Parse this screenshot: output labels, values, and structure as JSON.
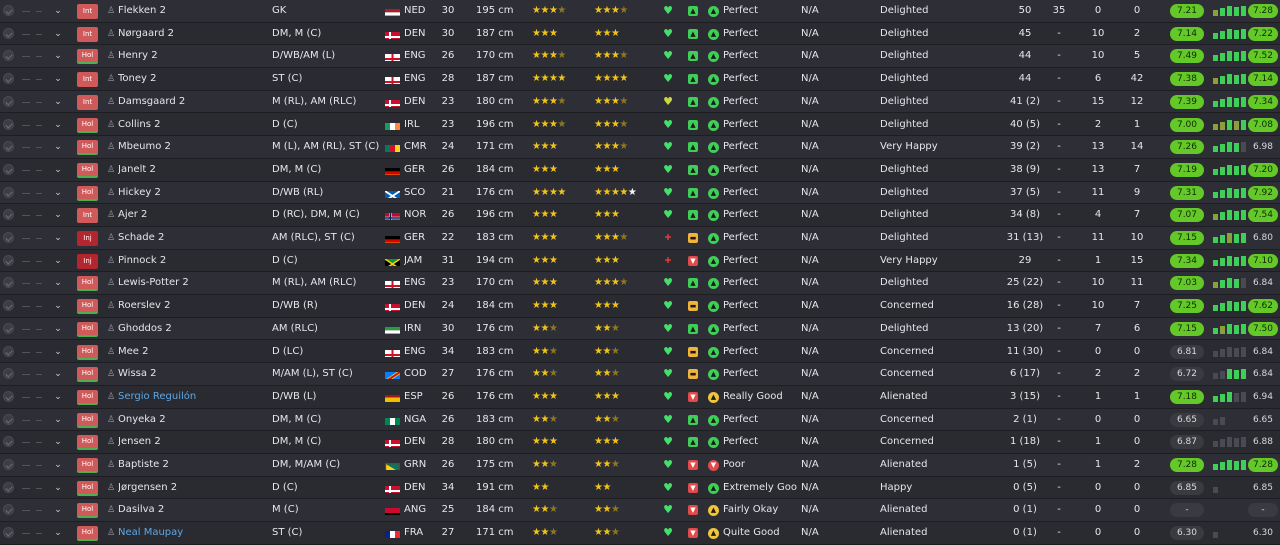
{
  "colors": {
    "star": "#f2c418",
    "rating_green": "#64c928",
    "status_red": "#d05a5a",
    "injured_red": "#b4262e",
    "blue_name": "#5ca8e6",
    "bar_green": "#3fcf58",
    "bar_olive": "#8aa03a",
    "bar_dark": "#4a4a52"
  },
  "players": [
    {
      "status": "Int",
      "name": "Flekken 2",
      "position": "GK",
      "nat": "NED",
      "flag": "ned",
      "age": "30",
      "height": "195 cm",
      "ca": "★★★½",
      "pa": "★★★½",
      "heart": "green",
      "morale": "green",
      "happy_icon": "green",
      "happiness": "Perfect",
      "na": "N/A",
      "feeling": "Delighted",
      "apps": "50",
      "goals": "35",
      "assists": "0",
      "col4": "0",
      "rating": "7.21",
      "rating_style": "green",
      "bars": [
        "o",
        "g",
        "g",
        "g",
        "g"
      ],
      "avg": "7.28",
      "avg_style": "green"
    },
    {
      "status": "Int",
      "name": "Nørgaard 2",
      "position": "DM, M (C)",
      "nat": "DEN",
      "flag": "den",
      "age": "30",
      "height": "187 cm",
      "ca": "★★★",
      "pa": "★★★",
      "heart": "green",
      "morale": "green",
      "happy_icon": "green",
      "happiness": "Perfect",
      "na": "N/A",
      "feeling": "Delighted",
      "apps": "45",
      "goals": "-",
      "assists": "10",
      "col4": "2",
      "rating": "7.14",
      "rating_style": "green",
      "bars": [
        "g",
        "g",
        "g",
        "g",
        "g"
      ],
      "avg": "7.22",
      "avg_style": "green"
    },
    {
      "status": "Hol",
      "name": "Henry 2",
      "position": "D/WB/AM (L)",
      "nat": "ENG",
      "flag": "eng",
      "age": "26",
      "height": "170 cm",
      "ca": "★★★½",
      "pa": "★★★½",
      "heart": "green",
      "morale": "green",
      "happy_icon": "green",
      "happiness": "Perfect",
      "na": "N/A",
      "feeling": "Delighted",
      "apps": "44",
      "goals": "-",
      "assists": "10",
      "col4": "5",
      "rating": "7.49",
      "rating_style": "green",
      "bars": [
        "g",
        "g",
        "g",
        "g",
        "g"
      ],
      "avg": "7.52",
      "avg_style": "green"
    },
    {
      "status": "Int",
      "name": "Toney 2",
      "position": "ST (C)",
      "nat": "ENG",
      "flag": "eng",
      "age": "28",
      "height": "187 cm",
      "ca": "★★★★",
      "pa": "★★★★",
      "heart": "green",
      "morale": "green",
      "happy_icon": "green",
      "happiness": "Perfect",
      "na": "N/A",
      "feeling": "Delighted",
      "apps": "44",
      "goals": "-",
      "assists": "6",
      "col4": "42",
      "rating": "7.38",
      "rating_style": "green",
      "bars": [
        "o",
        "g",
        "g",
        "g",
        "g"
      ],
      "avg": "7.14",
      "avg_style": "green"
    },
    {
      "status": "Int",
      "name": "Damsgaard 2",
      "position": "M (RL), AM (RLC)",
      "nat": "DEN",
      "flag": "den",
      "age": "23",
      "height": "180 cm",
      "ca": "★★★½",
      "pa": "★★★½",
      "heart": "yellowish",
      "morale": "green",
      "happy_icon": "green",
      "happiness": "Perfect",
      "na": "N/A",
      "feeling": "Delighted",
      "apps": "41 (2)",
      "goals": "-",
      "assists": "15",
      "col4": "12",
      "rating": "7.39",
      "rating_style": "green",
      "bars": [
        "g",
        "g",
        "g",
        "g",
        "g"
      ],
      "avg": "7.34",
      "avg_style": "green"
    },
    {
      "status": "Hol",
      "name": "Collins 2",
      "position": "D (C)",
      "nat": "IRL",
      "flag": "irl",
      "age": "23",
      "height": "196 cm",
      "ca": "★★★½",
      "pa": "★★★½",
      "heart": "green",
      "morale": "green",
      "happy_icon": "green",
      "happiness": "Perfect",
      "na": "N/A",
      "feeling": "Delighted",
      "apps": "40 (5)",
      "goals": "-",
      "assists": "2",
      "col4": "1",
      "rating": "7.00",
      "rating_style": "green",
      "bars": [
        "o",
        "o",
        "g",
        "o",
        "g"
      ],
      "avg": "7.08",
      "avg_style": "green"
    },
    {
      "status": "Hol",
      "name": "Mbeumo 2",
      "position": "M (L), AM (RL), ST (C)",
      "nat": "CMR",
      "flag": "cmr",
      "age": "24",
      "height": "171 cm",
      "ca": "★★★",
      "pa": "★★★½",
      "heart": "green",
      "morale": "green",
      "happy_icon": "green",
      "happiness": "Perfect",
      "na": "N/A",
      "feeling": "Very Happy",
      "apps": "39 (2)",
      "goals": "-",
      "assists": "13",
      "col4": "14",
      "rating": "7.26",
      "rating_style": "green",
      "bars": [
        "g",
        "g",
        "g",
        "g",
        "d"
      ],
      "avg": "6.98",
      "avg_style": "grey"
    },
    {
      "status": "Hol",
      "name": "Janelt 2",
      "position": "DM, M (C)",
      "nat": "GER",
      "flag": "ger",
      "age": "26",
      "height": "184 cm",
      "ca": "★★★",
      "pa": "★★★",
      "heart": "green",
      "morale": "green",
      "happy_icon": "green",
      "happiness": "Perfect",
      "na": "N/A",
      "feeling": "Delighted",
      "apps": "38 (9)",
      "goals": "-",
      "assists": "13",
      "col4": "7",
      "rating": "7.19",
      "rating_style": "green",
      "bars": [
        "g",
        "g",
        "g",
        "g",
        "g"
      ],
      "avg": "7.20",
      "avg_style": "green"
    },
    {
      "status": "Hol",
      "name": "Hickey 2",
      "position": "D/WB (RL)",
      "nat": "SCO",
      "flag": "sco",
      "age": "21",
      "height": "176 cm",
      "ca": "★★★★",
      "pa": "★★★★★",
      "heart": "green",
      "morale": "green",
      "happy_icon": "green",
      "happiness": "Perfect",
      "na": "N/A",
      "feeling": "Delighted",
      "apps": "37 (5)",
      "goals": "-",
      "assists": "11",
      "col4": "9",
      "rating": "7.31",
      "rating_style": "green",
      "bars": [
        "g",
        "g",
        "g",
        "g",
        "g"
      ],
      "avg": "7.92",
      "avg_style": "green"
    },
    {
      "status": "Int",
      "name": "Ajer 2",
      "position": "D (RC), DM, M (C)",
      "nat": "NOR",
      "flag": "nor",
      "age": "26",
      "height": "196 cm",
      "ca": "★★★",
      "pa": "★★★",
      "heart": "green",
      "morale": "green",
      "happy_icon": "green",
      "happiness": "Perfect",
      "na": "N/A",
      "feeling": "Delighted",
      "apps": "34 (8)",
      "goals": "-",
      "assists": "4",
      "col4": "7",
      "rating": "7.07",
      "rating_style": "green",
      "bars": [
        "o",
        "g",
        "g",
        "g",
        "g"
      ],
      "avg": "7.54",
      "avg_style": "green"
    },
    {
      "status": "Inj",
      "name": "Schade 2",
      "position": "AM (RLC), ST (C)",
      "nat": "GER",
      "flag": "ger",
      "age": "22",
      "height": "183 cm",
      "ca": "★★★",
      "pa": "★★★½",
      "heart": "red",
      "morale": "yellow",
      "happy_icon": "green",
      "happiness": "Perfect",
      "na": "N/A",
      "feeling": "Delighted",
      "apps": "31 (13)",
      "goals": "-",
      "assists": "11",
      "col4": "10",
      "rating": "7.15",
      "rating_style": "green",
      "bars": [
        "g",
        "g",
        "o",
        "g",
        "g"
      ],
      "avg": "6.80",
      "avg_style": "grey"
    },
    {
      "status": "Inj",
      "name": "Pinnock 2",
      "position": "D (C)",
      "nat": "JAM",
      "flag": "jam",
      "age": "31",
      "height": "194 cm",
      "ca": "★★★",
      "pa": "★★★",
      "heart": "red",
      "morale": "red",
      "happy_icon": "green",
      "happiness": "Perfect",
      "na": "N/A",
      "feeling": "Very Happy",
      "apps": "29",
      "goals": "-",
      "assists": "1",
      "col4": "15",
      "rating": "7.34",
      "rating_style": "green",
      "bars": [
        "g",
        "g",
        "g",
        "g",
        "g"
      ],
      "avg": "7.10",
      "avg_style": "green"
    },
    {
      "status": "Hol",
      "name": "Lewis-Potter 2",
      "position": "M (RL), AM (RLC)",
      "nat": "ENG",
      "flag": "eng",
      "age": "23",
      "height": "170 cm",
      "ca": "★★★",
      "pa": "★★★½",
      "heart": "green",
      "morale": "green",
      "happy_icon": "green",
      "happiness": "Perfect",
      "na": "N/A",
      "feeling": "Delighted",
      "apps": "25 (22)",
      "goals": "-",
      "assists": "10",
      "col4": "11",
      "rating": "7.03",
      "rating_style": "green",
      "bars": [
        "o",
        "g",
        "g",
        "g",
        "d"
      ],
      "avg": "6.84",
      "avg_style": "grey"
    },
    {
      "status": "Hol",
      "name": "Roerslev 2",
      "position": "D/WB (R)",
      "nat": "DEN",
      "flag": "den",
      "age": "24",
      "height": "184 cm",
      "ca": "★★★",
      "pa": "★★★",
      "heart": "green",
      "morale": "yellow",
      "happy_icon": "green",
      "happiness": "Perfect",
      "na": "N/A",
      "feeling": "Concerned",
      "apps": "16 (28)",
      "goals": "-",
      "assists": "10",
      "col4": "7",
      "rating": "7.25",
      "rating_style": "green",
      "bars": [
        "g",
        "g",
        "g",
        "g",
        "g"
      ],
      "avg": "7.62",
      "avg_style": "green"
    },
    {
      "status": "Hol",
      "name": "Ghoddos 2",
      "position": "AM (RLC)",
      "nat": "IRN",
      "flag": "irn",
      "age": "30",
      "height": "176 cm",
      "ca": "★★½",
      "pa": "★★½",
      "heart": "green",
      "morale": "green",
      "happy_icon": "green",
      "happiness": "Perfect",
      "na": "N/A",
      "feeling": "Delighted",
      "apps": "13 (20)",
      "goals": "-",
      "assists": "7",
      "col4": "6",
      "rating": "7.15",
      "rating_style": "green",
      "bars": [
        "g",
        "o",
        "g",
        "g",
        "g"
      ],
      "avg": "7.50",
      "avg_style": "green"
    },
    {
      "status": "Hol",
      "name": "Mee 2",
      "position": "D (LC)",
      "nat": "ENG",
      "flag": "eng",
      "age": "34",
      "height": "183 cm",
      "ca": "★★½",
      "pa": "★★½",
      "heart": "green",
      "morale": "yellow",
      "happy_icon": "green",
      "happiness": "Perfect",
      "na": "N/A",
      "feeling": "Concerned",
      "apps": "11 (30)",
      "goals": "-",
      "assists": "0",
      "col4": "0",
      "rating": "6.81",
      "rating_style": "grey",
      "bars": [
        "d",
        "d",
        "d",
        "d",
        "d"
      ],
      "avg": "6.84",
      "avg_style": "grey"
    },
    {
      "status": "Hol",
      "name": "Wissa 2",
      "position": "M/AM (L), ST (C)",
      "nat": "COD",
      "flag": "cod",
      "age": "27",
      "height": "176 cm",
      "ca": "★★½",
      "pa": "★★½",
      "heart": "green",
      "morale": "yellow",
      "happy_icon": "green",
      "happiness": "Perfect",
      "na": "N/A",
      "feeling": "Concerned",
      "apps": "6 (17)",
      "goals": "-",
      "assists": "2",
      "col4": "2",
      "rating": "6.72",
      "rating_style": "grey",
      "bars": [
        "d",
        "d",
        "g",
        "g",
        "g"
      ],
      "avg": "6.84",
      "avg_style": "grey"
    },
    {
      "status": "Hol",
      "name": "Sergio Reguilón",
      "name_blue": true,
      "position": "D/WB (L)",
      "nat": "ESP",
      "flag": "esp",
      "age": "26",
      "height": "176 cm",
      "ca": "★★★",
      "pa": "★★★",
      "heart": "green",
      "morale": "red",
      "happy_icon": "yellow",
      "happiness": "Really Good",
      "na": "N/A",
      "feeling": "Alienated",
      "apps": "3 (15)",
      "goals": "-",
      "assists": "1",
      "col4": "1",
      "rating": "7.18",
      "rating_style": "green",
      "bars": [
        "g",
        "g",
        "g",
        "d",
        "d"
      ],
      "avg": "6.94",
      "avg_style": "grey"
    },
    {
      "status": "Hol",
      "name": "Onyeka 2",
      "position": "DM, M (C)",
      "nat": "NGA",
      "flag": "nga",
      "age": "26",
      "height": "183 cm",
      "ca": "★★½",
      "pa": "★★½",
      "heart": "green",
      "morale": "green",
      "happy_icon": "green",
      "happiness": "Perfect",
      "na": "N/A",
      "feeling": "Concerned",
      "apps": "2 (1)",
      "goals": "-",
      "assists": "0",
      "col4": "0",
      "rating": "6.65",
      "rating_style": "grey",
      "bars": [
        "d",
        "d"
      ],
      "avg": "6.65",
      "avg_style": "grey"
    },
    {
      "status": "Hol",
      "name": "Jensen 2",
      "position": "DM, M (C)",
      "nat": "DEN",
      "flag": "den",
      "age": "28",
      "height": "180 cm",
      "ca": "★★★",
      "pa": "★★★",
      "heart": "green",
      "morale": "green",
      "happy_icon": "green",
      "happiness": "Perfect",
      "na": "N/A",
      "feeling": "Concerned",
      "apps": "1 (18)",
      "goals": "-",
      "assists": "1",
      "col4": "0",
      "rating": "6.87",
      "rating_style": "grey",
      "bars": [
        "d",
        "d",
        "d",
        "d",
        "d"
      ],
      "avg": "6.88",
      "avg_style": "grey"
    },
    {
      "status": "Hol",
      "name": "Baptiste 2",
      "position": "DM, M/AM (C)",
      "nat": "GRN",
      "flag": "grn",
      "age": "26",
      "height": "175 cm",
      "ca": "★★½",
      "pa": "★★½",
      "heart": "green",
      "morale": "red",
      "happy_icon": "red",
      "happiness": "Poor",
      "na": "N/A",
      "feeling": "Alienated",
      "apps": "1 (5)",
      "goals": "-",
      "assists": "1",
      "col4": "2",
      "rating": "7.28",
      "rating_style": "green",
      "bars": [
        "g",
        "g",
        "g",
        "g",
        "g"
      ],
      "avg": "7.28",
      "avg_style": "green"
    },
    {
      "status": "Hol",
      "name": "Jørgensen 2",
      "position": "D (C)",
      "nat": "DEN",
      "flag": "den",
      "age": "34",
      "height": "191 cm",
      "ca": "★★",
      "pa": "★★",
      "heart": "green",
      "morale": "red",
      "happy_icon": "green",
      "happiness": "Extremely Good",
      "na": "N/A",
      "feeling": "Happy",
      "apps": "0 (5)",
      "goals": "-",
      "assists": "0",
      "col4": "0",
      "rating": "6.85",
      "rating_style": "grey",
      "bars": [
        "d"
      ],
      "avg": "6.85",
      "avg_style": "grey"
    },
    {
      "status": "Hol",
      "name": "Dasilva 2",
      "position": "M (C)",
      "nat": "ANG",
      "flag": "ang",
      "age": "25",
      "height": "184 cm",
      "ca": "★★½",
      "pa": "★★½",
      "heart": "green",
      "morale": "red",
      "happy_icon": "yellow",
      "happiness": "Fairly Okay",
      "na": "N/A",
      "feeling": "Alienated",
      "apps": "0 (1)",
      "goals": "-",
      "assists": "0",
      "col4": "0",
      "rating": "-",
      "rating_style": "grey",
      "bars": [],
      "avg": "-",
      "avg_style": "dash"
    },
    {
      "status": "Hol",
      "name": "Neal Maupay",
      "name_blue": true,
      "position": "ST (C)",
      "nat": "FRA",
      "flag": "fra",
      "age": "27",
      "height": "171 cm",
      "ca": "★★½",
      "pa": "★★½",
      "heart": "green",
      "morale": "red",
      "happy_icon": "yellow",
      "happiness": "Quite Good",
      "na": "N/A",
      "feeling": "Alienated",
      "apps": "0 (1)",
      "goals": "-",
      "assists": "0",
      "col4": "0",
      "rating": "6.30",
      "rating_style": "grey",
      "bars": [
        "d"
      ],
      "avg": "6.30",
      "avg_style": "grey"
    }
  ]
}
